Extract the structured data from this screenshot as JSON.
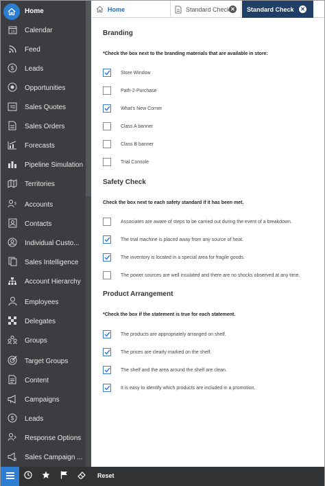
{
  "sidebar": {
    "items": [
      {
        "label": "Home",
        "icon": "home-icon",
        "active": true
      },
      {
        "label": "Calendar",
        "icon": "calendar-icon"
      },
      {
        "label": "Feed",
        "icon": "feed-icon"
      },
      {
        "label": "Leads",
        "icon": "dollar-icon"
      },
      {
        "label": "Opportunities",
        "icon": "opportunities-icon"
      },
      {
        "label": "Sales Quotes",
        "icon": "quote-icon"
      },
      {
        "label": "Sales Orders",
        "icon": "order-icon"
      },
      {
        "label": "Forecasts",
        "icon": "forecast-icon"
      },
      {
        "label": "Pipeline Simulation",
        "icon": "pipeline-icon"
      },
      {
        "label": "Territories",
        "icon": "territory-icon"
      },
      {
        "label": "Accounts",
        "icon": "accounts-icon"
      },
      {
        "label": "Contacts",
        "icon": "contacts-icon"
      },
      {
        "label": "Individual Custo...",
        "icon": "individual-customer-icon"
      },
      {
        "label": "Sales Intelligence",
        "icon": "intelligence-icon"
      },
      {
        "label": "Account Hierarchy",
        "icon": "hierarchy-icon"
      },
      {
        "label": "Employees",
        "icon": "employee-icon"
      },
      {
        "label": "Delegates",
        "icon": "delegates-icon"
      },
      {
        "label": "Groups",
        "icon": "groups-icon"
      },
      {
        "label": "Target Groups",
        "icon": "target-icon"
      },
      {
        "label": "Content",
        "icon": "content-icon"
      },
      {
        "label": "Campaigns",
        "icon": "megaphone-icon"
      },
      {
        "label": "Leads",
        "icon": "dollar-icon"
      },
      {
        "label": "Response Options",
        "icon": "response-icon"
      },
      {
        "label": "Sales Campaign ...",
        "icon": "sales-campaign-icon"
      }
    ]
  },
  "bottombar": {
    "reset_label": "Reset"
  },
  "tabs": {
    "home": "Home",
    "standard_check_1": "Standard Check",
    "standard_check_2": "Standard Check"
  },
  "sections": {
    "branding": {
      "title": "Branding",
      "instruction": "*Check the box next to the branding materials that are available in store:",
      "items": [
        {
          "label": "Store Window",
          "checked": true
        },
        {
          "label": "Path-2-Purchase",
          "checked": false
        },
        {
          "label": "What's New Corner",
          "checked": true
        },
        {
          "label": "Class A banner",
          "checked": false
        },
        {
          "label": "Class B banner",
          "checked": false
        },
        {
          "label": "Trial Console",
          "checked": false
        }
      ]
    },
    "safety": {
      "title": "Safety Check",
      "instruction": "Check the box next to each safety standard if it has been met.",
      "items": [
        {
          "label": "Associates are aware of steps to be carried out during the event of a breakdown.",
          "checked": false
        },
        {
          "label": "The trial machine is placed away from any source of heat.",
          "checked": true
        },
        {
          "label": "The inventory is located in a special area for fragile goods.",
          "checked": true
        },
        {
          "label": "The power sources are well insulated and there are no shocks observed at any time.",
          "checked": false
        }
      ]
    },
    "product": {
      "title": "Product Arrangement",
      "instruction": "*Check the box if the statement is true for each statement.",
      "items": [
        {
          "label": "The products are appropriately arranged on shelf.",
          "checked": true
        },
        {
          "label": "The prices are clearly marked on the shelf.",
          "checked": true
        },
        {
          "label": "The shelf and the area around the shelf are clean.",
          "checked": true
        },
        {
          "label": "It is easy to identify which products are included in a promotion.",
          "checked": true
        }
      ]
    }
  },
  "colors": {
    "accent": "#2d7dd2",
    "sidebar_bg": "#3b3d40",
    "active_tab": "#1f3f66",
    "check": "#3a7bd5"
  }
}
